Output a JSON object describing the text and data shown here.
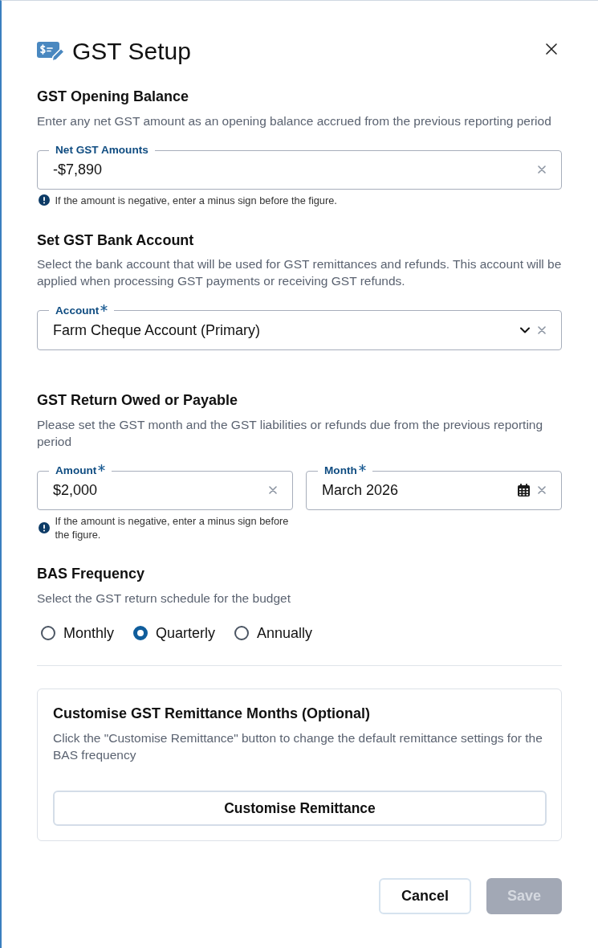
{
  "dialog": {
    "title": "GST Setup"
  },
  "sections": [
    {
      "heading": "GST Opening Balance",
      "description": "Enter any net GST amount as an opening balance accrued from the previous reporting period",
      "fields": [
        {
          "kind": "text",
          "label": "Net GST Amounts",
          "required": false,
          "value": "-$7,890",
          "helper": "If the amount is negative, enter a minus sign before the figure."
        }
      ]
    },
    {
      "heading": "Set GST Bank Account",
      "description": "Select the bank account that will be used for GST remittances and refunds. This account will be applied when processing GST payments or receiving GST refunds.",
      "fields": [
        {
          "kind": "select",
          "label": "Account",
          "required": true,
          "value": "Farm Cheque Account (Primary)"
        }
      ]
    },
    {
      "heading": "GST Return Owed or Payable",
      "description": "Please set the GST month and the GST liabilities or refunds due from the previous reporting period",
      "fields": [
        {
          "kind": "text",
          "label": "Amount",
          "required": true,
          "value": "$2,000",
          "helper": "If the amount is negative, enter a minus sign before the figure."
        },
        {
          "kind": "date",
          "label": "Month",
          "required": true,
          "value": "March 2026"
        }
      ]
    },
    {
      "heading": "BAS Frequency",
      "description": "Select the GST return schedule for the budget",
      "options": [
        {
          "label": "Monthly",
          "selected": false
        },
        {
          "label": "Quarterly",
          "selected": true
        },
        {
          "label": "Annually",
          "selected": false
        }
      ]
    }
  ],
  "remittance_card": {
    "title": "Customise GST Remittance Months (Optional)",
    "description": "Click the \"Customise Remittance\" button to change the default remittance settings for the BAS frequency",
    "button": "Customise Remittance"
  },
  "buttons": [
    {
      "kind": "secondary",
      "label": "Cancel",
      "disabled": false
    },
    {
      "kind": "primary",
      "label": "Save",
      "disabled": true
    }
  ]
}
